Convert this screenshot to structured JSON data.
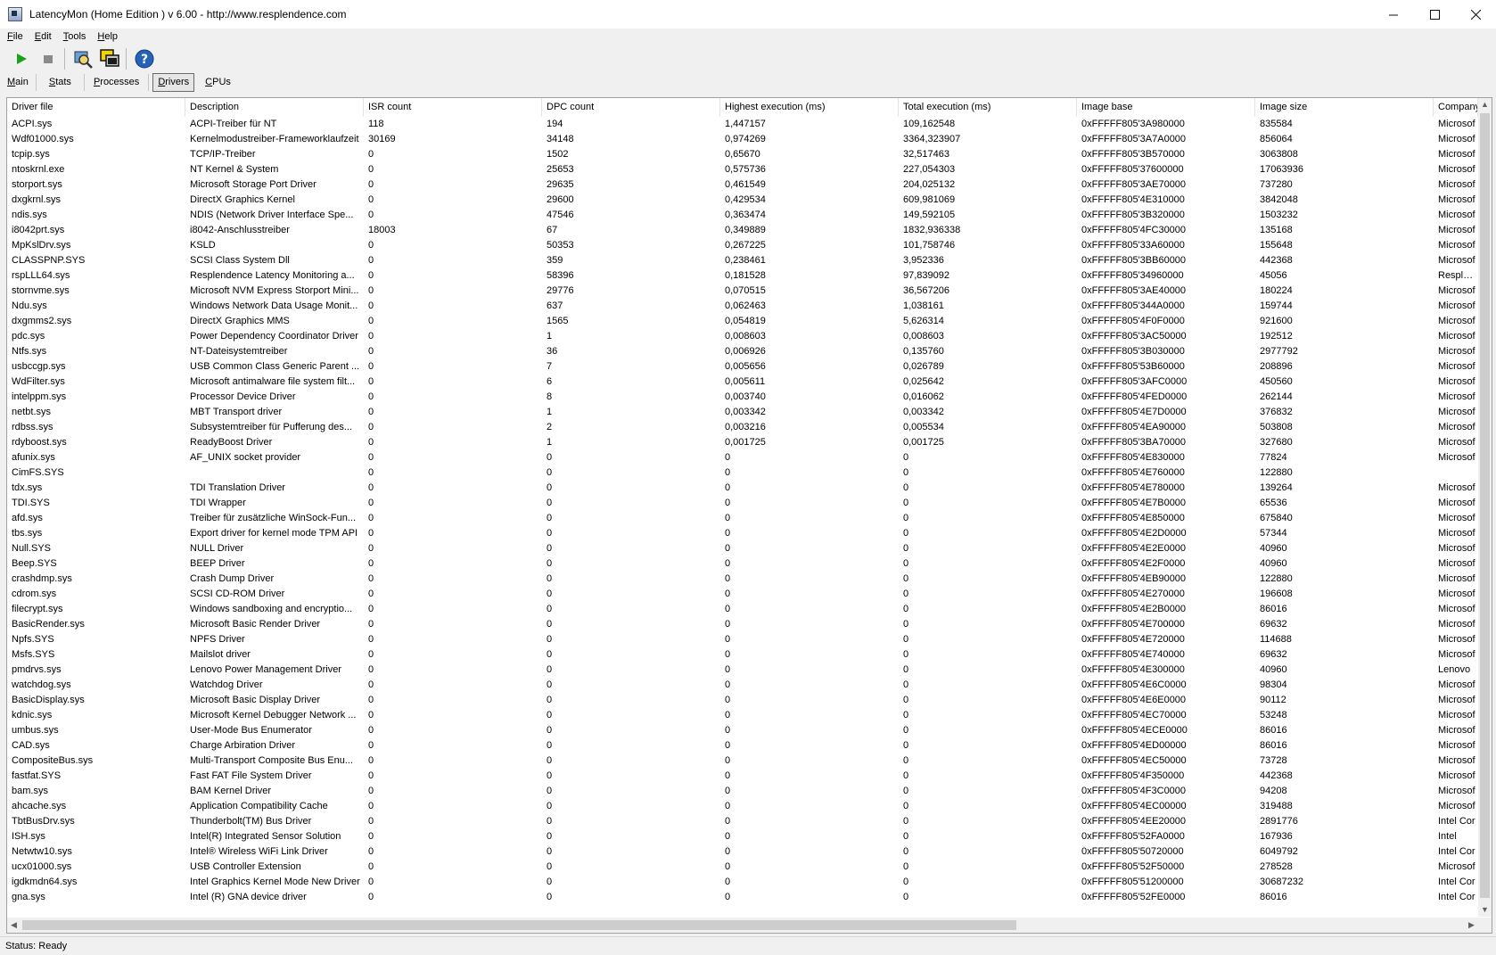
{
  "window": {
    "title": "LatencyMon  (Home Edition )  v 6.00 - http://www.resplendence.com",
    "controls": {
      "minimize": "—",
      "maximize": "☐",
      "close": "✕"
    }
  },
  "menu": [
    {
      "label": "File",
      "accel": "F",
      "rest": "ile"
    },
    {
      "label": "Edit",
      "accel": "E",
      "rest": "dit"
    },
    {
      "label": "Tools",
      "accel": "T",
      "rest": "ools"
    },
    {
      "label": "Help",
      "accel": "H",
      "rest": "elp"
    }
  ],
  "toolbar": {
    "icons": [
      "play-icon",
      "stop-icon",
      "search-tool-icon",
      "windows-icon",
      "help-icon"
    ],
    "colors": {
      "play": "#1aa31a",
      "stop": "#8a8a8a",
      "help": "#2563b8"
    }
  },
  "tabs": [
    {
      "label": "Main",
      "accel": "M",
      "rest": "ain",
      "active": false
    },
    {
      "label": "Stats",
      "accel": "S",
      "rest": "tats",
      "active": false
    },
    {
      "label": "Processes",
      "accel": "P",
      "rest": "rocesses",
      "active": false
    },
    {
      "label": "Drivers",
      "accel": "D",
      "rest": "rivers",
      "active": true
    },
    {
      "label": "CPUs",
      "accel": "C",
      "rest": "PUs",
      "active": false
    }
  ],
  "table": {
    "columns": [
      "Driver file",
      "Description",
      "ISR count",
      "DPC count",
      "Highest execution (ms)",
      "Total execution (ms)",
      "Image base",
      "Image size",
      "Company"
    ],
    "rows": [
      [
        "ACPI.sys",
        "ACPI-Treiber für NT",
        "118",
        "194",
        "1,447157",
        "109,162548",
        "0xFFFFF805'3A980000",
        "835584",
        "Microsof"
      ],
      [
        "Wdf01000.sys",
        "Kernelmodustreiber-Frameworklaufzeit",
        "30169",
        "34148",
        "0,974269",
        "3364,323907",
        "0xFFFFF805'3A7A0000",
        "856064",
        "Microsof"
      ],
      [
        "tcpip.sys",
        "TCP/IP-Treiber",
        "0",
        "1502",
        "0,65670",
        "32,517463",
        "0xFFFFF805'3B570000",
        "3063808",
        "Microsof"
      ],
      [
        "ntoskrnl.exe",
        "NT Kernel & System",
        "0",
        "25653",
        "0,575736",
        "227,054303",
        "0xFFFFF805'37600000",
        "17063936",
        "Microsof"
      ],
      [
        "storport.sys",
        "Microsoft Storage Port Driver",
        "0",
        "29635",
        "0,461549",
        "204,025132",
        "0xFFFFF805'3AE70000",
        "737280",
        "Microsof"
      ],
      [
        "dxgkrnl.sys",
        "DirectX Graphics Kernel",
        "0",
        "29600",
        "0,429534",
        "609,981069",
        "0xFFFFF805'4E310000",
        "3842048",
        "Microsof"
      ],
      [
        "ndis.sys",
        "NDIS (Network Driver Interface Spe...",
        "0",
        "47546",
        "0,363474",
        "149,592105",
        "0xFFFFF805'3B320000",
        "1503232",
        "Microsof"
      ],
      [
        "i8042prt.sys",
        "i8042-Anschlusstreiber",
        "18003",
        "67",
        "0,349889",
        "1832,936338",
        "0xFFFFF805'4FC30000",
        "135168",
        "Microsof"
      ],
      [
        "MpKslDrv.sys",
        "KSLD",
        "0",
        "50353",
        "0,267225",
        "101,758746",
        "0xFFFFF805'33A60000",
        "155648",
        "Microsof"
      ],
      [
        "CLASSPNP.SYS",
        "SCSI Class System Dll",
        "0",
        "359",
        "0,238461",
        "3,952336",
        "0xFFFFF805'3BB60000",
        "442368",
        "Microsof"
      ],
      [
        "rspLLL64.sys",
        "Resplendence Latency Monitoring a...",
        "0",
        "58396",
        "0,181528",
        "97,839092",
        "0xFFFFF805'34960000",
        "45056",
        "Resplenc"
      ],
      [
        "stornvme.sys",
        "Microsoft NVM Express Storport Mini...",
        "0",
        "29776",
        "0,070515",
        "36,567206",
        "0xFFFFF805'3AE40000",
        "180224",
        "Microsof"
      ],
      [
        "Ndu.sys",
        "Windows Network Data Usage Monit...",
        "0",
        "637",
        "0,062463",
        "1,038161",
        "0xFFFFF805'344A0000",
        "159744",
        "Microsof"
      ],
      [
        "dxgmms2.sys",
        "DirectX Graphics MMS",
        "0",
        "1565",
        "0,054819",
        "5,626314",
        "0xFFFFF805'4F0F0000",
        "921600",
        "Microsof"
      ],
      [
        "pdc.sys",
        "Power Dependency Coordinator Driver",
        "0",
        "1",
        "0,008603",
        "0,008603",
        "0xFFFFF805'3AC50000",
        "192512",
        "Microsof"
      ],
      [
        "Ntfs.sys",
        "NT-Dateisystemtreiber",
        "0",
        "36",
        "0,006926",
        "0,135760",
        "0xFFFFF805'3B030000",
        "2977792",
        "Microsof"
      ],
      [
        "usbccgp.sys",
        "USB Common Class Generic Parent ...",
        "0",
        "7",
        "0,005656",
        "0,026789",
        "0xFFFFF805'53B60000",
        "208896",
        "Microsof"
      ],
      [
        "WdFilter.sys",
        "Microsoft antimalware file system filt...",
        "0",
        "6",
        "0,005611",
        "0,025642",
        "0xFFFFF805'3AFC0000",
        "450560",
        "Microsof"
      ],
      [
        "intelppm.sys",
        "Processor Device Driver",
        "0",
        "8",
        "0,003740",
        "0,016062",
        "0xFFFFF805'4FED0000",
        "262144",
        "Microsof"
      ],
      [
        "netbt.sys",
        "MBT Transport driver",
        "0",
        "1",
        "0,003342",
        "0,003342",
        "0xFFFFF805'4E7D0000",
        "376832",
        "Microsof"
      ],
      [
        "rdbss.sys",
        "Subsystemtreiber für Pufferung des...",
        "0",
        "2",
        "0,003216",
        "0,005534",
        "0xFFFFF805'4EA90000",
        "503808",
        "Microsof"
      ],
      [
        "rdyboost.sys",
        "ReadyBoost Driver",
        "0",
        "1",
        "0,001725",
        "0,001725",
        "0xFFFFF805'3BA70000",
        "327680",
        "Microsof"
      ],
      [
        "afunix.sys",
        "AF_UNIX socket provider",
        "0",
        "0",
        "0",
        "0",
        "0xFFFFF805'4E830000",
        "77824",
        "Microsof"
      ],
      [
        "CimFS.SYS",
        "",
        "0",
        "0",
        "0",
        "0",
        "0xFFFFF805'4E760000",
        "122880",
        ""
      ],
      [
        "tdx.sys",
        "TDI Translation Driver",
        "0",
        "0",
        "0",
        "0",
        "0xFFFFF805'4E780000",
        "139264",
        "Microsof"
      ],
      [
        "TDI.SYS",
        "TDI Wrapper",
        "0",
        "0",
        "0",
        "0",
        "0xFFFFF805'4E7B0000",
        "65536",
        "Microsof"
      ],
      [
        "afd.sys",
        "Treiber für zusätzliche WinSock-Fun...",
        "0",
        "0",
        "0",
        "0",
        "0xFFFFF805'4E850000",
        "675840",
        "Microsof"
      ],
      [
        "tbs.sys",
        "Export driver for kernel mode TPM API",
        "0",
        "0",
        "0",
        "0",
        "0xFFFFF805'4E2D0000",
        "57344",
        "Microsof"
      ],
      [
        "Null.SYS",
        "NULL Driver",
        "0",
        "0",
        "0",
        "0",
        "0xFFFFF805'4E2E0000",
        "40960",
        "Microsof"
      ],
      [
        "Beep.SYS",
        "BEEP Driver",
        "0",
        "0",
        "0",
        "0",
        "0xFFFFF805'4E2F0000",
        "40960",
        "Microsof"
      ],
      [
        "crashdmp.sys",
        "Crash Dump Driver",
        "0",
        "0",
        "0",
        "0",
        "0xFFFFF805'4EB90000",
        "122880",
        "Microsof"
      ],
      [
        "cdrom.sys",
        "SCSI CD-ROM Driver",
        "0",
        "0",
        "0",
        "0",
        "0xFFFFF805'4E270000",
        "196608",
        "Microsof"
      ],
      [
        "filecrypt.sys",
        "Windows sandboxing and encryptio...",
        "0",
        "0",
        "0",
        "0",
        "0xFFFFF805'4E2B0000",
        "86016",
        "Microsof"
      ],
      [
        "BasicRender.sys",
        "Microsoft Basic Render Driver",
        "0",
        "0",
        "0",
        "0",
        "0xFFFFF805'4E700000",
        "69632",
        "Microsof"
      ],
      [
        "Npfs.SYS",
        "NPFS Driver",
        "0",
        "0",
        "0",
        "0",
        "0xFFFFF805'4E720000",
        "114688",
        "Microsof"
      ],
      [
        "Msfs.SYS",
        "Mailslot driver",
        "0",
        "0",
        "0",
        "0",
        "0xFFFFF805'4E740000",
        "69632",
        "Microsof"
      ],
      [
        "pmdrvs.sys",
        "Lenovo Power Management Driver",
        "0",
        "0",
        "0",
        "0",
        "0xFFFFF805'4E300000",
        "40960",
        "Lenovo"
      ],
      [
        "watchdog.sys",
        "Watchdog Driver",
        "0",
        "0",
        "0",
        "0",
        "0xFFFFF805'4E6C0000",
        "98304",
        "Microsof"
      ],
      [
        "BasicDisplay.sys",
        "Microsoft Basic Display Driver",
        "0",
        "0",
        "0",
        "0",
        "0xFFFFF805'4E6E0000",
        "90112",
        "Microsof"
      ],
      [
        "kdnic.sys",
        "Microsoft Kernel Debugger Network ...",
        "0",
        "0",
        "0",
        "0",
        "0xFFFFF805'4EC70000",
        "53248",
        "Microsof"
      ],
      [
        "umbus.sys",
        "User-Mode Bus Enumerator",
        "0",
        "0",
        "0",
        "0",
        "0xFFFFF805'4ECE0000",
        "86016",
        "Microsof"
      ],
      [
        "CAD.sys",
        "Charge Arbiration Driver",
        "0",
        "0",
        "0",
        "0",
        "0xFFFFF805'4ED00000",
        "86016",
        "Microsof"
      ],
      [
        "CompositeBus.sys",
        "Multi-Transport Composite Bus Enu...",
        "0",
        "0",
        "0",
        "0",
        "0xFFFFF805'4EC50000",
        "73728",
        "Microsof"
      ],
      [
        "fastfat.SYS",
        "Fast FAT File System Driver",
        "0",
        "0",
        "0",
        "0",
        "0xFFFFF805'4F350000",
        "442368",
        "Microsof"
      ],
      [
        "bam.sys",
        "BAM Kernel Driver",
        "0",
        "0",
        "0",
        "0",
        "0xFFFFF805'4F3C0000",
        "94208",
        "Microsof"
      ],
      [
        "ahcache.sys",
        "Application Compatibility Cache",
        "0",
        "0",
        "0",
        "0",
        "0xFFFFF805'4EC00000",
        "319488",
        "Microsof"
      ],
      [
        "TbtBusDrv.sys",
        "Thunderbolt(TM) Bus Driver",
        "0",
        "0",
        "0",
        "0",
        "0xFFFFF805'4EE20000",
        "2891776",
        "Intel Cor"
      ],
      [
        "ISH.sys",
        "Intel(R) Integrated Sensor Solution",
        "0",
        "0",
        "0",
        "0",
        "0xFFFFF805'52FA0000",
        "167936",
        "Intel"
      ],
      [
        "Netwtw10.sys",
        "Intel® Wireless WiFi Link Driver",
        "0",
        "0",
        "0",
        "0",
        "0xFFFFF805'50720000",
        "6049792",
        "Intel Cor"
      ],
      [
        "ucx01000.sys",
        "USB Controller Extension",
        "0",
        "0",
        "0",
        "0",
        "0xFFFFF805'52F50000",
        "278528",
        "Microsof"
      ],
      [
        "igdkmdn64.sys",
        "Intel Graphics Kernel Mode New Driver",
        "0",
        "0",
        "0",
        "0",
        "0xFFFFF805'51200000",
        "30687232",
        "Intel Cor"
      ],
      [
        "gna.sys",
        "Intel (R) GNA device driver",
        "0",
        "0",
        "0",
        "0",
        "0xFFFFF805'52FE0000",
        "86016",
        "Intel Cor"
      ]
    ]
  },
  "scrollbars": {
    "up": "▲",
    "down": "▼",
    "left": "◀",
    "right": "▶"
  },
  "status": {
    "text": "Status: Ready"
  }
}
